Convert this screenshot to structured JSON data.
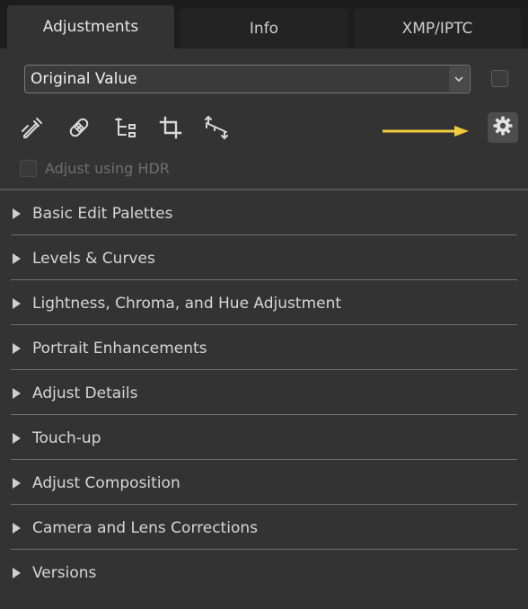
{
  "tabs": [
    {
      "label": "Adjustments",
      "active": true
    },
    {
      "label": "Info",
      "active": false
    },
    {
      "label": "XMP/IPTC",
      "active": false
    }
  ],
  "preset": {
    "value": "Original Value"
  },
  "toolbar": {
    "tools": [
      "eyedropper-icon",
      "bandage-icon",
      "tree-icon",
      "crop-icon",
      "straighten-icon"
    ],
    "settings": "gear-icon"
  },
  "annotation": {
    "arrow_color": "#f0cc3c"
  },
  "hdr": {
    "label": "Adjust using HDR",
    "checked": false,
    "enabled": false
  },
  "sections": [
    {
      "label": "Basic Edit Palettes"
    },
    {
      "label": "Levels & Curves"
    },
    {
      "label": "Lightness, Chroma, and Hue Adjustment"
    },
    {
      "label": "Portrait Enhancements"
    },
    {
      "label": "Adjust Details"
    },
    {
      "label": "Touch-up"
    },
    {
      "label": "Adjust Composition"
    },
    {
      "label": "Camera and Lens Corrections"
    },
    {
      "label": "Versions"
    }
  ]
}
